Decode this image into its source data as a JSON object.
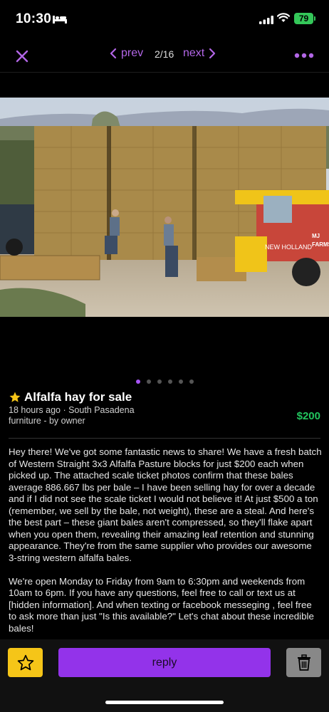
{
  "status": {
    "time": "10:30",
    "battery": "79"
  },
  "nav": {
    "prev_label": "prev",
    "counter": "2/16",
    "next_label": "next"
  },
  "gallery": {
    "dot_count": 6,
    "active_index": 0
  },
  "listing": {
    "title": "Alfalfa hay for sale",
    "meta_line1": "18 hours ago · South Pasadena",
    "meta_line2": "furniture - by owner",
    "price": "$200",
    "description": [
      "Hey there! We've got some fantastic news to share! We have a fresh batch of Western Straight 3x3 Alfalfa Pasture blocks for just $200 each when picked up. The attached scale ticket photos confirm that these bales average 886.667 lbs per bale – I have been selling hay for over a decade and if I did not see the scale ticket I would not believe it! At just $500 a ton (remember, we sell by the bale, not weight), these are a steal. And here's the best part – these giant bales aren't compressed, so they'll flake apart when you open them, revealing their amazing leaf retention and stunning appearance. They're from the same supplier who provides our awesome 3-string western alfalfa bales.",
      "We're open Monday to Friday from 9am to 6:30pm and weekends from 10am to 6pm. If you have any questions, feel free to call or text us at [hidden information]. And when texting or facebook messeging , feel free to ask more than just \"Is this available?\" Let's chat about these incredible bales!"
    ]
  },
  "actions": {
    "reply_label": "reply"
  },
  "colors": {
    "accent": "#b266e6",
    "price": "#22c55e",
    "favorite": "#f5c518",
    "reply": "#9333ea",
    "delete": "#888888"
  }
}
